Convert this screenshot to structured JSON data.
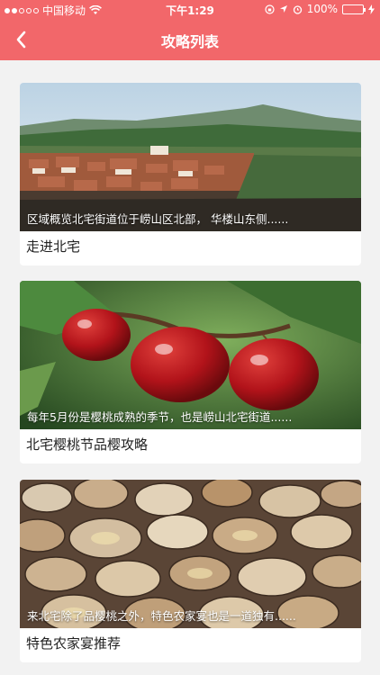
{
  "status_bar": {
    "carrier": "中国移动",
    "time": "下午1:29",
    "battery": "100%"
  },
  "nav": {
    "title": "攻略列表",
    "back_icon": "chevron-left-icon"
  },
  "articles": [
    {
      "summary": "区域概览北宅街道位于崂山区北部， 华楼山东侧......",
      "title": "走进北宅",
      "image": "village-landscape"
    },
    {
      "summary": "每年5月份是樱桃成熟的季节，也是崂山北宅街道......",
      "title": "北宅樱桃节品樱攻略",
      "image": "cherries"
    },
    {
      "summary": "来北宅除了品樱桃之外，特色农家宴也是一道独有......",
      "title": "特色农家宴推荐",
      "image": "clams"
    }
  ],
  "colors": {
    "header": "#f2676a",
    "background": "#f2f2f2"
  }
}
